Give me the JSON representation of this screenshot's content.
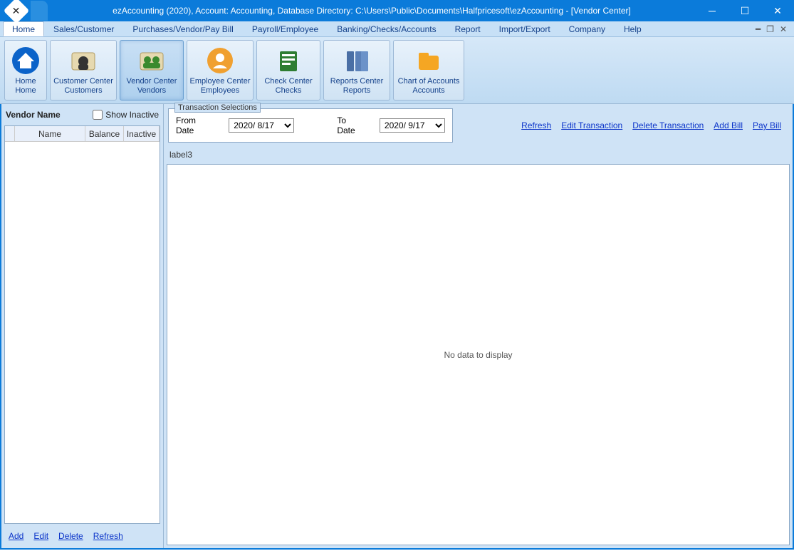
{
  "titlebar": {
    "text": "ezAccounting (2020), Account: Accounting, Database Directory: C:\\Users\\Public\\Documents\\Halfpricesoft\\ezAccounting - [Vendor Center]"
  },
  "menu": {
    "items": [
      "Home",
      "Sales/Customer",
      "Purchases/Vendor/Pay Bill",
      "Payroll/Employee",
      "Banking/Checks/Accounts",
      "Report",
      "Import/Export",
      "Company",
      "Help"
    ],
    "activeIndex": 0
  },
  "ribbon": {
    "buttons": [
      {
        "label": "Home",
        "sublabel": "Home",
        "icon": "home"
      },
      {
        "label": "Customer Center",
        "sublabel": "Customers",
        "icon": "customer"
      },
      {
        "label": "Vendor Center",
        "sublabel": "Vendors",
        "icon": "vendor"
      },
      {
        "label": "Employee Center",
        "sublabel": "Employees",
        "icon": "employee"
      },
      {
        "label": "Check Center",
        "sublabel": "Checks",
        "icon": "check"
      },
      {
        "label": "Reports Center",
        "sublabel": "Reports",
        "icon": "reports"
      },
      {
        "label": "Chart of Accounts",
        "sublabel": "Accounts",
        "icon": "accounts"
      }
    ],
    "activeIndex": 2
  },
  "leftPanel": {
    "title": "Vendor Name",
    "showInactiveLabel": "Show Inactive",
    "showInactiveChecked": false,
    "columns": [
      "",
      "Name",
      "Balance",
      "Inactive"
    ],
    "actions": {
      "add": "Add",
      "edit": "Edit",
      "delete": "Delete",
      "refresh": "Refresh"
    }
  },
  "rightPanel": {
    "transSelections": {
      "legend": "Transaction Selections",
      "fromLabel": "From Date",
      "fromValue": "2020/ 8/17",
      "toLabel": "To Date",
      "toValue": "2020/ 9/17"
    },
    "actions": {
      "refresh": "Refresh",
      "edit": "Edit Transaction",
      "delete": "Delete Transaction",
      "addBill": "Add Bill",
      "payBill": "Pay Bill"
    },
    "label3": "label3",
    "noData": "No data to display"
  }
}
